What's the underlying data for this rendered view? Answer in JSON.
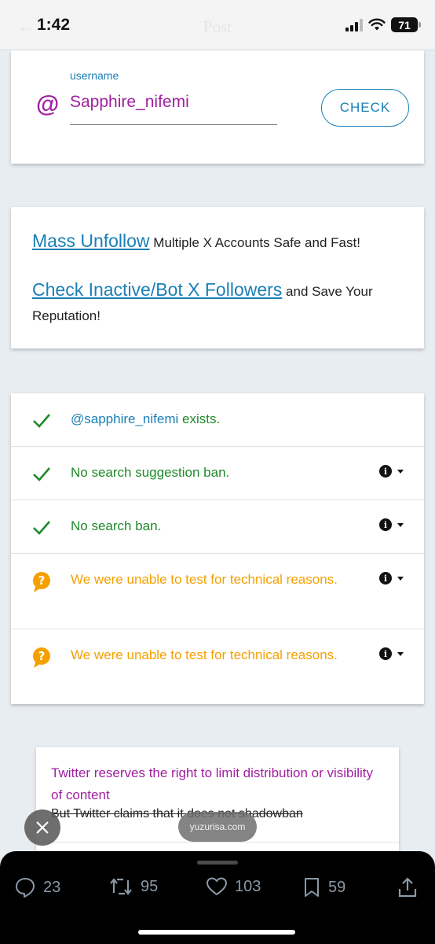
{
  "status_bar": {
    "time": "1:42",
    "battery": "71",
    "ghost_title": "Post"
  },
  "username_card": {
    "field_label": "username",
    "field_value": "Sapphire_nifemi",
    "check_label": "CHECK"
  },
  "promo_card": {
    "line1_link": "Mass Unfollow",
    "line1_text": "Multiple X Accounts Safe and Fast!",
    "line2_link": "Check Inactive/Bot X Followers",
    "line2_text": "and Save Your Reputation!"
  },
  "results": [
    {
      "status": "ok",
      "handle": "@sapphire_nifemi",
      "text": "exists."
    },
    {
      "status": "ok",
      "text": "No search suggestion ban."
    },
    {
      "status": "ok",
      "text": "No search ban."
    },
    {
      "status": "warn",
      "text": "We were unable to test for technical reasons."
    },
    {
      "status": "warn",
      "text": "We were unable to test for technical reasons."
    }
  ],
  "note_card": {
    "title": "Twitter reserves the right to limit distribution or visibility of content",
    "subtitle": "But Twitter claims that it does not shadowban"
  },
  "overlay": {
    "url": "yuzurisa.com"
  },
  "engagement": {
    "replies": "23",
    "reposts": "95",
    "likes": "103",
    "bookmarks": "59"
  },
  "colors": {
    "accent_blue": "#1a7fb5",
    "purple": "#a020a0",
    "ok_green": "#1f8a2a",
    "warn_orange": "#f5a000"
  }
}
